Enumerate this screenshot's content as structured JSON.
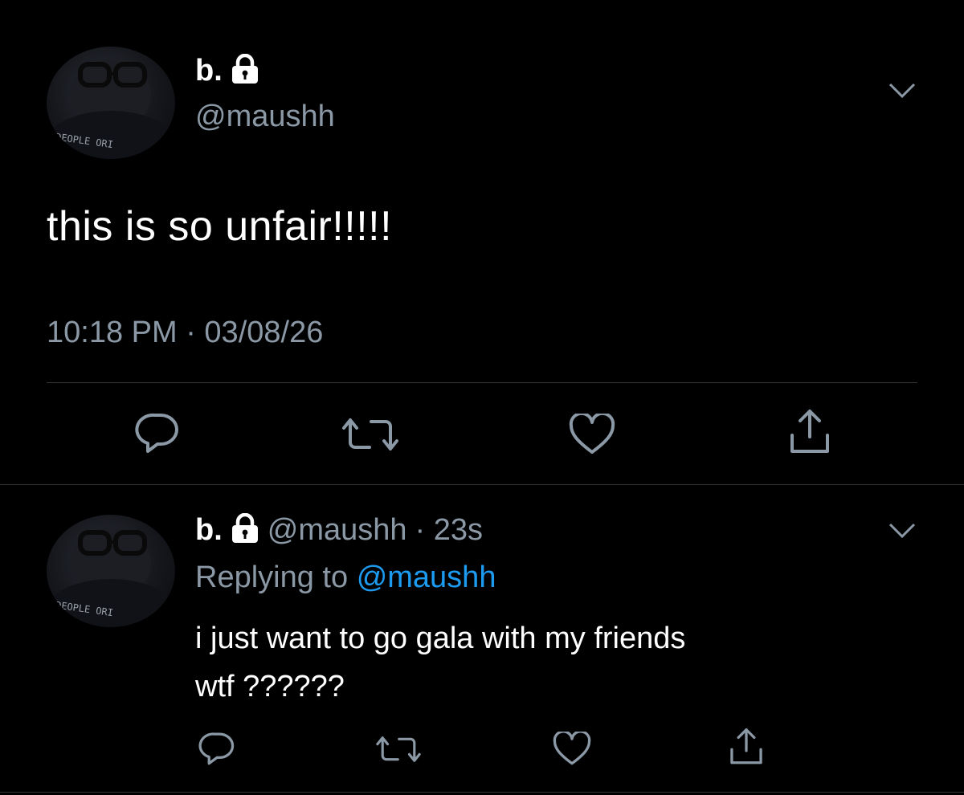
{
  "main_tweet": {
    "display_name": "b.",
    "handle": "@maushh",
    "text": "this is so unfair!!!!!",
    "timestamp": "10:18 PM · 03/08/26"
  },
  "reply_tweet": {
    "display_name": "b.",
    "handle": "@maushh",
    "age": "· 23s",
    "replying_prefix": "Replying to",
    "replying_to": "@maushh",
    "text_line1": "i just want to go gala with my friends",
    "text_line2": "wtf ??????"
  },
  "avatar_caption": "DEOPLE ORI",
  "icons": [
    "reply-icon",
    "retweet-icon",
    "like-icon",
    "share-icon",
    "lock-icon",
    "chevron-down-icon"
  ],
  "colors": {
    "background": "#000000",
    "muted": "#8b98a5",
    "link": "#1d9bf0",
    "divider": "#2f3336"
  }
}
